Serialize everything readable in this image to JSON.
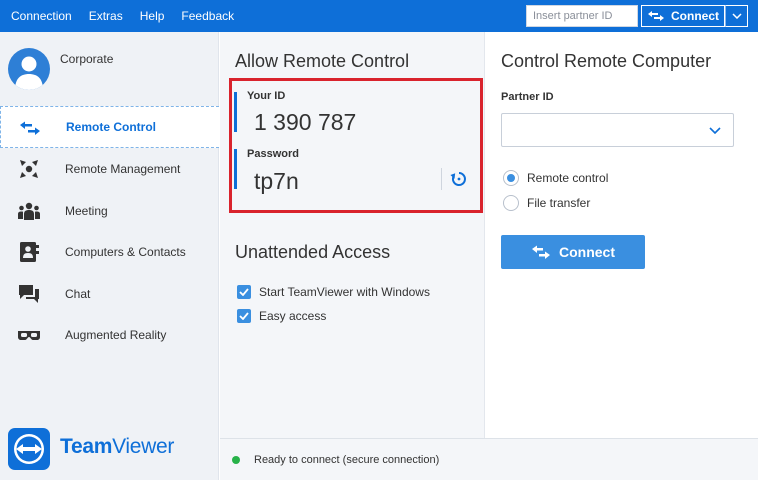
{
  "menu": {
    "items": [
      "Connection",
      "Extras",
      "Help",
      "Feedback"
    ]
  },
  "topbar": {
    "partner_placeholder": "Insert partner ID",
    "connect_label": "Connect"
  },
  "sidebar": {
    "profile_name": "Corporate",
    "items": [
      {
        "label": "Remote Control",
        "icon": "arrows-swap-icon",
        "active": true
      },
      {
        "label": "Remote Management",
        "icon": "management-icon",
        "active": false
      },
      {
        "label": "Meeting",
        "icon": "meeting-icon",
        "active": false
      },
      {
        "label": "Computers & Contacts",
        "icon": "contacts-icon",
        "active": false
      },
      {
        "label": "Chat",
        "icon": "chat-icon",
        "active": false
      },
      {
        "label": "Augmented Reality",
        "icon": "ar-glasses-icon",
        "active": false
      }
    ],
    "logo_text_bold": "Team",
    "logo_text_regular": "Viewer"
  },
  "allow": {
    "title": "Allow Remote Control",
    "your_id_label": "Your ID",
    "your_id_value": "1 390 787",
    "password_label": "Password",
    "password_value": "tp7n"
  },
  "unattended": {
    "title": "Unattended Access",
    "options": [
      {
        "label": "Start TeamViewer with Windows",
        "checked": true
      },
      {
        "label": "Easy access",
        "checked": true
      }
    ]
  },
  "control": {
    "title": "Control Remote Computer",
    "partner_id_label": "Partner ID",
    "partner_id_value": "",
    "modes": [
      {
        "label": "Remote control",
        "selected": true
      },
      {
        "label": "File transfer",
        "selected": false
      }
    ],
    "connect_label": "Connect"
  },
  "status": {
    "text": "Ready to connect (secure connection)",
    "color": "#27b249"
  },
  "colors": {
    "brand": "#0e6fd8",
    "accent": "#3a8fe0",
    "highlight": "#d9232d"
  }
}
